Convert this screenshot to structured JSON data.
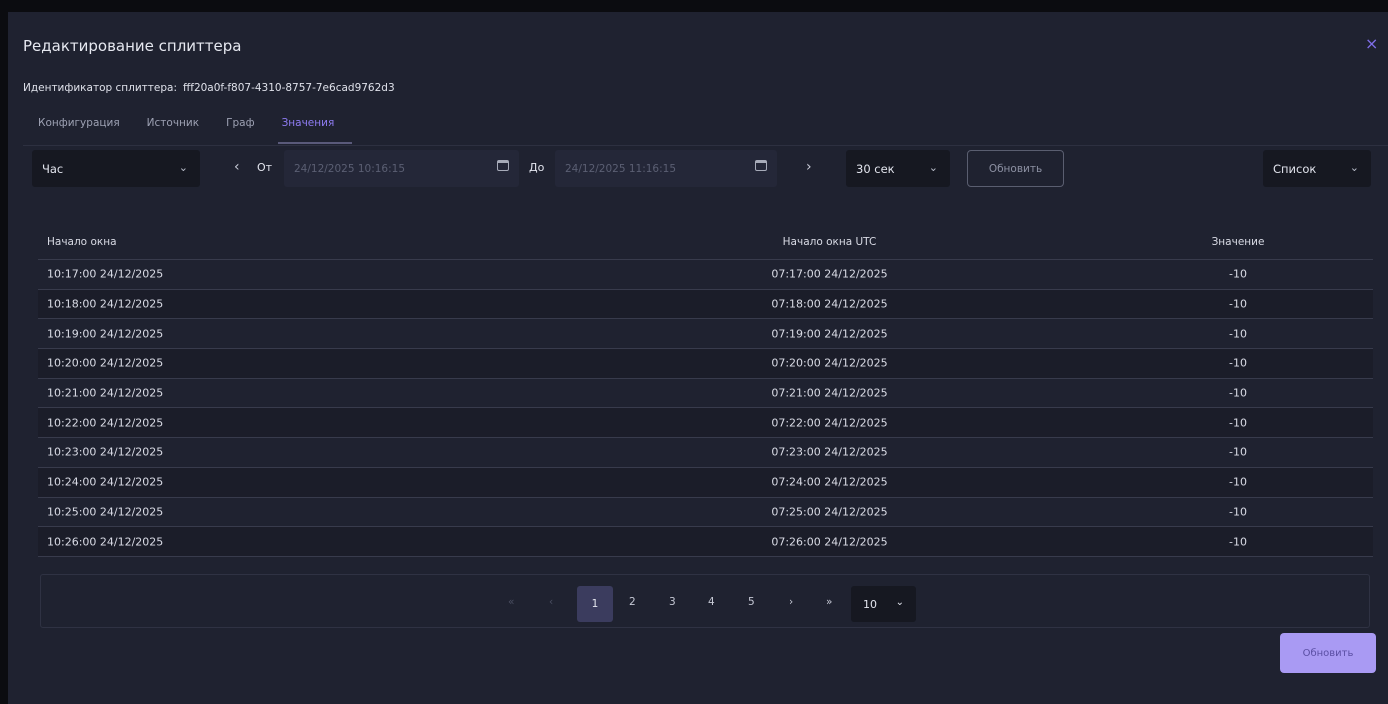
{
  "modal": {
    "title": "Редактирование сплиттера",
    "close_glyph": "×",
    "id_label": "Идентификатор сплиттера:",
    "id_value": "fff20a0f-f807-4310-8757-7e6cad9762d3"
  },
  "tabs": [
    {
      "label": "Конфигурация",
      "active": false
    },
    {
      "label": "Источник",
      "active": false
    },
    {
      "label": "Граф",
      "active": false
    },
    {
      "label": "Значения",
      "active": true
    }
  ],
  "toolbar": {
    "period": "Час",
    "from_label": "От",
    "from_value": "24/12/2025 10:16:15",
    "to_label": "До",
    "to_value": "24/12/2025 11:16:15",
    "interval": "30 сек",
    "refresh_label": "Обновить",
    "view_mode": "Список",
    "prev_glyph": "‹",
    "next_glyph": "›",
    "chevron_glyph": "⌄"
  },
  "table": {
    "columns": [
      "Начало окна",
      "Начало окна UTC",
      "Значение"
    ],
    "rows": [
      {
        "start": "10:17:00 24/12/2025",
        "start_utc": "07:17:00 24/12/2025",
        "value": "-10"
      },
      {
        "start": "10:18:00 24/12/2025",
        "start_utc": "07:18:00 24/12/2025",
        "value": "-10"
      },
      {
        "start": "10:19:00 24/12/2025",
        "start_utc": "07:19:00 24/12/2025",
        "value": "-10"
      },
      {
        "start": "10:20:00 24/12/2025",
        "start_utc": "07:20:00 24/12/2025",
        "value": "-10"
      },
      {
        "start": "10:21:00 24/12/2025",
        "start_utc": "07:21:00 24/12/2025",
        "value": "-10"
      },
      {
        "start": "10:22:00 24/12/2025",
        "start_utc": "07:22:00 24/12/2025",
        "value": "-10"
      },
      {
        "start": "10:23:00 24/12/2025",
        "start_utc": "07:23:00 24/12/2025",
        "value": "-10"
      },
      {
        "start": "10:24:00 24/12/2025",
        "start_utc": "07:24:00 24/12/2025",
        "value": "-10"
      },
      {
        "start": "10:25:00 24/12/2025",
        "start_utc": "07:25:00 24/12/2025",
        "value": "-10"
      },
      {
        "start": "10:26:00 24/12/2025",
        "start_utc": "07:26:00 24/12/2025",
        "value": "-10"
      }
    ]
  },
  "pagination": {
    "first_glyph": "«",
    "prev_glyph": "‹",
    "pages": [
      "1",
      "2",
      "3",
      "4",
      "5"
    ],
    "current_page": "1",
    "next_glyph": "›",
    "last_glyph": "»",
    "page_size": "10"
  },
  "footer": {
    "save_label": "Обновить"
  },
  "colors": {
    "accent": "#8e7cf2",
    "primary_button": "#a99af3",
    "modal_bg": "#1f2230"
  }
}
